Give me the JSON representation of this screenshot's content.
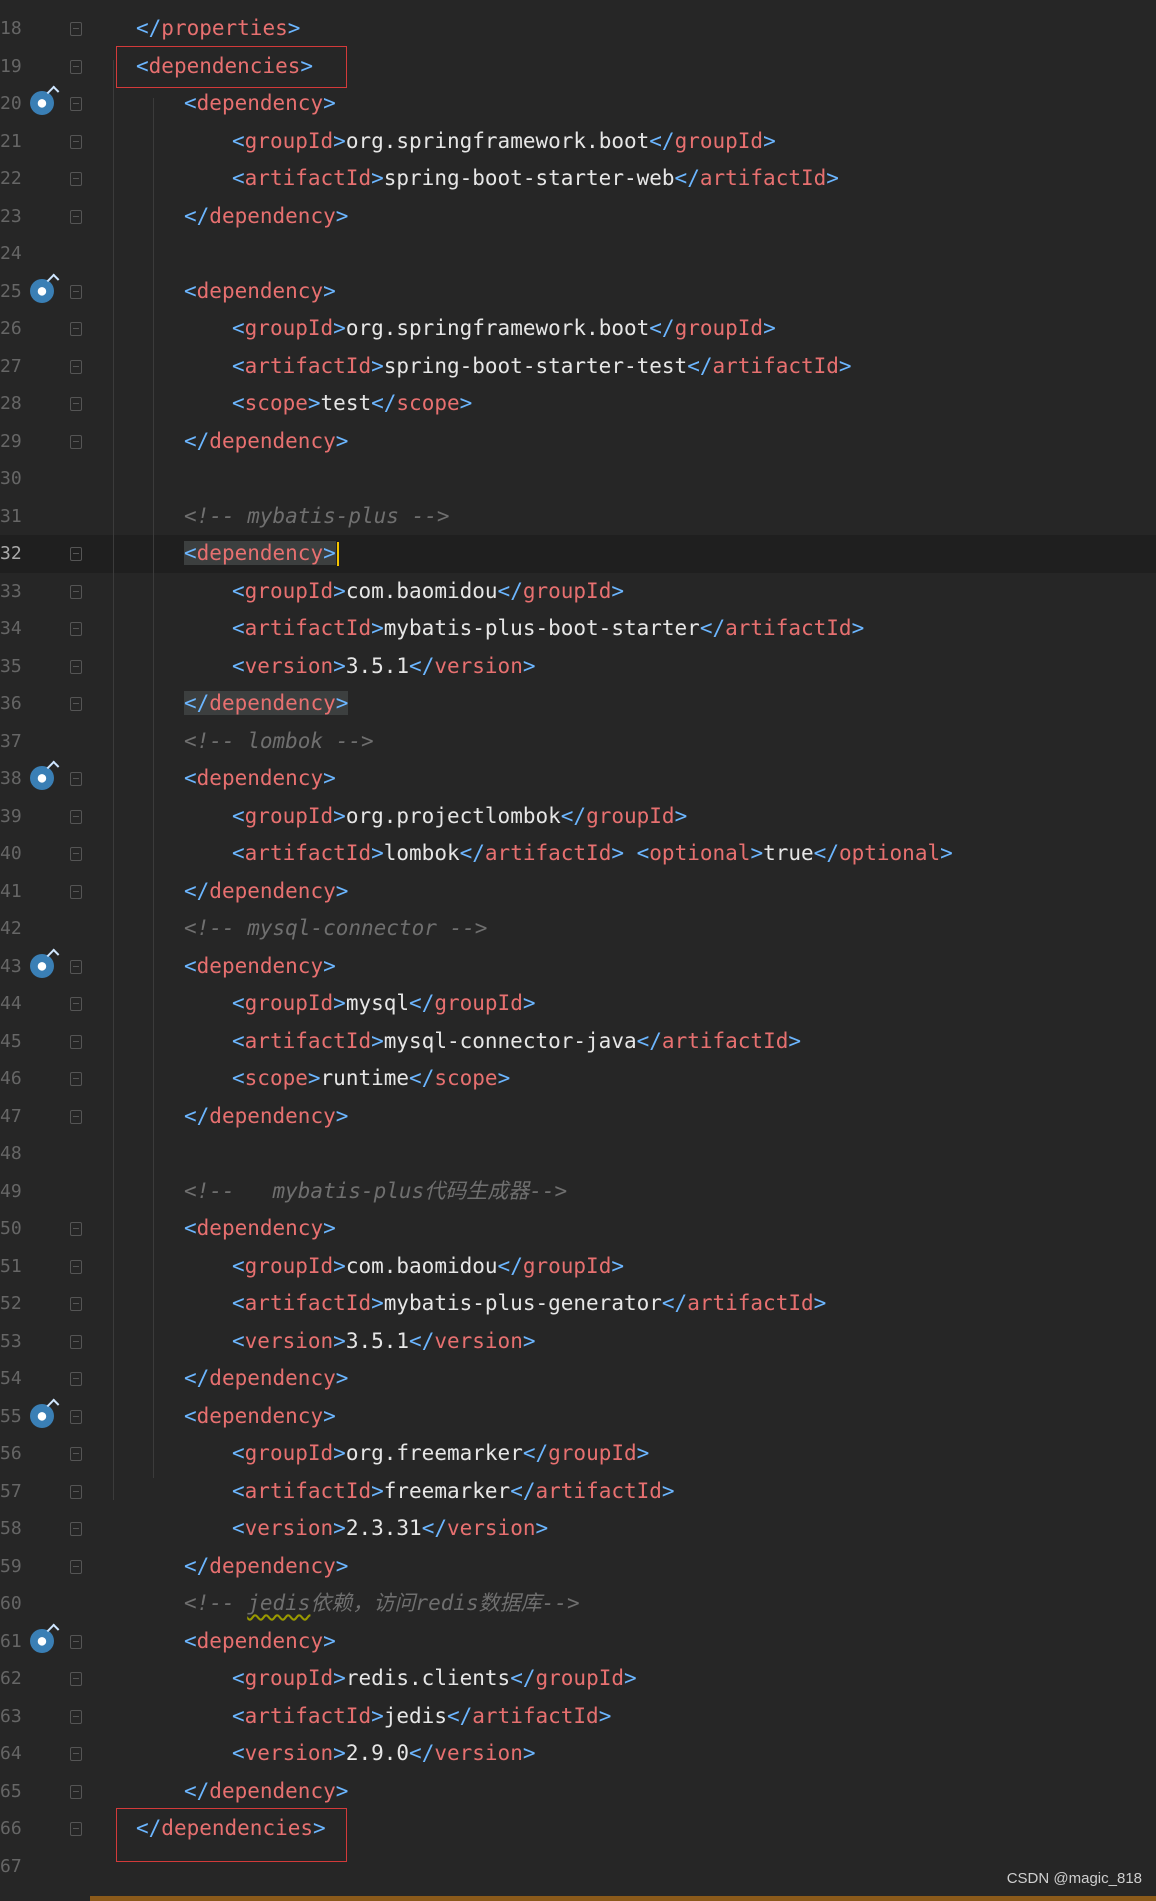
{
  "editor": {
    "lines": [
      {
        "n": "18",
        "indent": 1,
        "parts": [
          [
            "b",
            "</"
          ],
          [
            "t",
            "properties"
          ],
          [
            "b",
            ">"
          ]
        ]
      },
      {
        "n": "19",
        "indent": 1,
        "parts": [
          [
            "b",
            "<"
          ],
          [
            "t",
            "dependencies"
          ],
          [
            "b",
            ">"
          ]
        ]
      },
      {
        "n": "20",
        "indent": 2,
        "icon": true,
        "parts": [
          [
            "b",
            "<"
          ],
          [
            "t",
            "dependency"
          ],
          [
            "b",
            ">"
          ]
        ]
      },
      {
        "n": "21",
        "indent": 3,
        "parts": [
          [
            "b",
            "<"
          ],
          [
            "t",
            "groupId"
          ],
          [
            "b",
            ">"
          ],
          [
            "x",
            "org.springframework.boot"
          ],
          [
            "b",
            "</"
          ],
          [
            "t",
            "groupId"
          ],
          [
            "b",
            ">"
          ]
        ]
      },
      {
        "n": "22",
        "indent": 3,
        "parts": [
          [
            "b",
            "<"
          ],
          [
            "t",
            "artifactId"
          ],
          [
            "b",
            ">"
          ],
          [
            "x",
            "spring-boot-starter-web"
          ],
          [
            "b",
            "</"
          ],
          [
            "t",
            "artifactId"
          ],
          [
            "b",
            ">"
          ]
        ]
      },
      {
        "n": "23",
        "indent": 2,
        "parts": [
          [
            "b",
            "</"
          ],
          [
            "t",
            "dependency"
          ],
          [
            "b",
            ">"
          ]
        ]
      },
      {
        "n": "24",
        "indent": 0,
        "parts": []
      },
      {
        "n": "25",
        "indent": 2,
        "icon": true,
        "parts": [
          [
            "b",
            "<"
          ],
          [
            "t",
            "dependency"
          ],
          [
            "b",
            ">"
          ]
        ]
      },
      {
        "n": "26",
        "indent": 3,
        "parts": [
          [
            "b",
            "<"
          ],
          [
            "t",
            "groupId"
          ],
          [
            "b",
            ">"
          ],
          [
            "x",
            "org.springframework.boot"
          ],
          [
            "b",
            "</"
          ],
          [
            "t",
            "groupId"
          ],
          [
            "b",
            ">"
          ]
        ]
      },
      {
        "n": "27",
        "indent": 3,
        "parts": [
          [
            "b",
            "<"
          ],
          [
            "t",
            "artifactId"
          ],
          [
            "b",
            ">"
          ],
          [
            "x",
            "spring-boot-starter-test"
          ],
          [
            "b",
            "</"
          ],
          [
            "t",
            "artifactId"
          ],
          [
            "b",
            ">"
          ]
        ]
      },
      {
        "n": "28",
        "indent": 3,
        "parts": [
          [
            "b",
            "<"
          ],
          [
            "t",
            "scope"
          ],
          [
            "b",
            ">"
          ],
          [
            "x",
            "test"
          ],
          [
            "b",
            "</"
          ],
          [
            "t",
            "scope"
          ],
          [
            "b",
            ">"
          ]
        ]
      },
      {
        "n": "29",
        "indent": 2,
        "parts": [
          [
            "b",
            "</"
          ],
          [
            "t",
            "dependency"
          ],
          [
            "b",
            ">"
          ]
        ]
      },
      {
        "n": "30",
        "indent": 0,
        "parts": []
      },
      {
        "n": "31",
        "indent": 2,
        "parts": [
          [
            "c",
            "<!-- mybatis-plus -->"
          ]
        ]
      },
      {
        "n": "32",
        "indent": 2,
        "current": true,
        "parts": [
          [
            "b",
            "<"
          ],
          [
            "t",
            "dependency"
          ],
          [
            "b",
            ">"
          ]
        ]
      },
      {
        "n": "33",
        "indent": 3,
        "parts": [
          [
            "b",
            "<"
          ],
          [
            "t",
            "groupId"
          ],
          [
            "b",
            ">"
          ],
          [
            "x",
            "com.baomidou"
          ],
          [
            "b",
            "</"
          ],
          [
            "t",
            "groupId"
          ],
          [
            "b",
            ">"
          ]
        ]
      },
      {
        "n": "34",
        "indent": 3,
        "parts": [
          [
            "b",
            "<"
          ],
          [
            "t",
            "artifactId"
          ],
          [
            "b",
            ">"
          ],
          [
            "x",
            "mybatis-plus-boot-starter"
          ],
          [
            "b",
            "</"
          ],
          [
            "t",
            "artifactId"
          ],
          [
            "b",
            ">"
          ]
        ]
      },
      {
        "n": "35",
        "indent": 3,
        "parts": [
          [
            "b",
            "<"
          ],
          [
            "t",
            "version"
          ],
          [
            "b",
            ">"
          ],
          [
            "x",
            "3.5.1"
          ],
          [
            "b",
            "</"
          ],
          [
            "t",
            "version"
          ],
          [
            "b",
            ">"
          ]
        ]
      },
      {
        "n": "36",
        "indent": 2,
        "match": true,
        "parts": [
          [
            "b",
            "</"
          ],
          [
            "t",
            "dependency"
          ],
          [
            "b",
            ">"
          ]
        ]
      },
      {
        "n": "37",
        "indent": 2,
        "parts": [
          [
            "c",
            "<!-- lombok -->"
          ]
        ]
      },
      {
        "n": "38",
        "indent": 2,
        "icon": true,
        "parts": [
          [
            "b",
            "<"
          ],
          [
            "t",
            "dependency"
          ],
          [
            "b",
            ">"
          ]
        ]
      },
      {
        "n": "39",
        "indent": 3,
        "parts": [
          [
            "b",
            "<"
          ],
          [
            "t",
            "groupId"
          ],
          [
            "b",
            ">"
          ],
          [
            "x",
            "org.projectlombok"
          ],
          [
            "b",
            "</"
          ],
          [
            "t",
            "groupId"
          ],
          [
            "b",
            ">"
          ]
        ]
      },
      {
        "n": "40",
        "indent": 3,
        "parts": [
          [
            "b",
            "<"
          ],
          [
            "t",
            "artifactId"
          ],
          [
            "b",
            ">"
          ],
          [
            "x",
            "lombok"
          ],
          [
            "b",
            "</"
          ],
          [
            "t",
            "artifactId"
          ],
          [
            "b",
            "> <"
          ],
          [
            "t",
            "optional"
          ],
          [
            "b",
            ">"
          ],
          [
            "x",
            "true"
          ],
          [
            "b",
            "</"
          ],
          [
            "t",
            "optional"
          ],
          [
            "b",
            ">"
          ]
        ]
      },
      {
        "n": "41",
        "indent": 2,
        "parts": [
          [
            "b",
            "</"
          ],
          [
            "t",
            "dependency"
          ],
          [
            "b",
            ">"
          ]
        ]
      },
      {
        "n": "42",
        "indent": 2,
        "parts": [
          [
            "c",
            "<!-- mysql-connector -->"
          ]
        ]
      },
      {
        "n": "43",
        "indent": 2,
        "icon": true,
        "parts": [
          [
            "b",
            "<"
          ],
          [
            "t",
            "dependency"
          ],
          [
            "b",
            ">"
          ]
        ]
      },
      {
        "n": "44",
        "indent": 3,
        "parts": [
          [
            "b",
            "<"
          ],
          [
            "t",
            "groupId"
          ],
          [
            "b",
            ">"
          ],
          [
            "x",
            "mysql"
          ],
          [
            "b",
            "</"
          ],
          [
            "t",
            "groupId"
          ],
          [
            "b",
            ">"
          ]
        ]
      },
      {
        "n": "45",
        "indent": 3,
        "parts": [
          [
            "b",
            "<"
          ],
          [
            "t",
            "artifactId"
          ],
          [
            "b",
            ">"
          ],
          [
            "x",
            "mysql-connector-java"
          ],
          [
            "b",
            "</"
          ],
          [
            "t",
            "artifactId"
          ],
          [
            "b",
            ">"
          ]
        ]
      },
      {
        "n": "46",
        "indent": 3,
        "parts": [
          [
            "b",
            "<"
          ],
          [
            "t",
            "scope"
          ],
          [
            "b",
            ">"
          ],
          [
            "x",
            "runtime"
          ],
          [
            "b",
            "</"
          ],
          [
            "t",
            "scope"
          ],
          [
            "b",
            ">"
          ]
        ]
      },
      {
        "n": "47",
        "indent": 2,
        "parts": [
          [
            "b",
            "</"
          ],
          [
            "t",
            "dependency"
          ],
          [
            "b",
            ">"
          ]
        ]
      },
      {
        "n": "48",
        "indent": 0,
        "parts": []
      },
      {
        "n": "49",
        "indent": 2,
        "parts": [
          [
            "c",
            "<!--   mybatis-plus代码生成器-->"
          ]
        ]
      },
      {
        "n": "50",
        "indent": 2,
        "parts": [
          [
            "b",
            "<"
          ],
          [
            "t",
            "dependency"
          ],
          [
            "b",
            ">"
          ]
        ]
      },
      {
        "n": "51",
        "indent": 3,
        "parts": [
          [
            "b",
            "<"
          ],
          [
            "t",
            "groupId"
          ],
          [
            "b",
            ">"
          ],
          [
            "x",
            "com.baomidou"
          ],
          [
            "b",
            "</"
          ],
          [
            "t",
            "groupId"
          ],
          [
            "b",
            ">"
          ]
        ]
      },
      {
        "n": "52",
        "indent": 3,
        "parts": [
          [
            "b",
            "<"
          ],
          [
            "t",
            "artifactId"
          ],
          [
            "b",
            ">"
          ],
          [
            "x",
            "mybatis-plus-generator"
          ],
          [
            "b",
            "</"
          ],
          [
            "t",
            "artifactId"
          ],
          [
            "b",
            ">"
          ]
        ]
      },
      {
        "n": "53",
        "indent": 3,
        "parts": [
          [
            "b",
            "<"
          ],
          [
            "t",
            "version"
          ],
          [
            "b",
            ">"
          ],
          [
            "x",
            "3.5.1"
          ],
          [
            "b",
            "</"
          ],
          [
            "t",
            "version"
          ],
          [
            "b",
            ">"
          ]
        ]
      },
      {
        "n": "54",
        "indent": 2,
        "parts": [
          [
            "b",
            "</"
          ],
          [
            "t",
            "dependency"
          ],
          [
            "b",
            ">"
          ]
        ]
      },
      {
        "n": "55",
        "indent": 2,
        "icon": true,
        "parts": [
          [
            "b",
            "<"
          ],
          [
            "t",
            "dependency"
          ],
          [
            "b",
            ">"
          ]
        ]
      },
      {
        "n": "56",
        "indent": 3,
        "parts": [
          [
            "b",
            "<"
          ],
          [
            "t",
            "groupId"
          ],
          [
            "b",
            ">"
          ],
          [
            "x",
            "org.freemarker"
          ],
          [
            "b",
            "</"
          ],
          [
            "t",
            "groupId"
          ],
          [
            "b",
            ">"
          ]
        ]
      },
      {
        "n": "57",
        "indent": 3,
        "parts": [
          [
            "b",
            "<"
          ],
          [
            "t",
            "artifactId"
          ],
          [
            "b",
            ">"
          ],
          [
            "x",
            "freemarker"
          ],
          [
            "b",
            "</"
          ],
          [
            "t",
            "artifactId"
          ],
          [
            "b",
            ">"
          ]
        ]
      },
      {
        "n": "58",
        "indent": 3,
        "parts": [
          [
            "b",
            "<"
          ],
          [
            "t",
            "version"
          ],
          [
            "b",
            ">"
          ],
          [
            "x",
            "2.3.31"
          ],
          [
            "b",
            "</"
          ],
          [
            "t",
            "version"
          ],
          [
            "b",
            ">"
          ]
        ]
      },
      {
        "n": "59",
        "indent": 2,
        "parts": [
          [
            "b",
            "</"
          ],
          [
            "t",
            "dependency"
          ],
          [
            "b",
            ">"
          ]
        ]
      },
      {
        "n": "60",
        "indent": 2,
        "parts": [
          [
            "c",
            "<!-- "
          ],
          [
            "cs",
            "jedis"
          ],
          [
            "c",
            "依赖，访问redis数据库-->"
          ]
        ]
      },
      {
        "n": "61",
        "indent": 2,
        "icon": true,
        "parts": [
          [
            "b",
            "<"
          ],
          [
            "t",
            "dependency"
          ],
          [
            "b",
            ">"
          ]
        ]
      },
      {
        "n": "62",
        "indent": 3,
        "parts": [
          [
            "b",
            "<"
          ],
          [
            "t",
            "groupId"
          ],
          [
            "b",
            ">"
          ],
          [
            "x",
            "redis.clients"
          ],
          [
            "b",
            "</"
          ],
          [
            "t",
            "groupId"
          ],
          [
            "b",
            ">"
          ]
        ]
      },
      {
        "n": "63",
        "indent": 3,
        "parts": [
          [
            "b",
            "<"
          ],
          [
            "t",
            "artifactId"
          ],
          [
            "b",
            ">"
          ],
          [
            "x",
            "jedis"
          ],
          [
            "b",
            "</"
          ],
          [
            "t",
            "artifactId"
          ],
          [
            "b",
            ">"
          ]
        ]
      },
      {
        "n": "64",
        "indent": 3,
        "parts": [
          [
            "b",
            "<"
          ],
          [
            "t",
            "version"
          ],
          [
            "b",
            ">"
          ],
          [
            "x",
            "2.9.0"
          ],
          [
            "b",
            "</"
          ],
          [
            "t",
            "version"
          ],
          [
            "b",
            ">"
          ]
        ]
      },
      {
        "n": "65",
        "indent": 2,
        "parts": [
          [
            "b",
            "</"
          ],
          [
            "t",
            "dependency"
          ],
          [
            "b",
            ">"
          ]
        ]
      },
      {
        "n": "66",
        "indent": 1,
        "parts": [
          [
            "b",
            "</"
          ],
          [
            "t",
            "dependencies"
          ],
          [
            "b",
            ">"
          ]
        ]
      },
      {
        "n": "67",
        "indent": 0,
        "parts": []
      }
    ]
  },
  "watermark": "CSDN @magic_818",
  "colors": {
    "background": "#262626",
    "bracket": "#6cb6ff",
    "tag": "#e77070",
    "text": "#e6e6e6",
    "comment": "#6f6f6f",
    "highlight_box": "#d33a3a"
  }
}
